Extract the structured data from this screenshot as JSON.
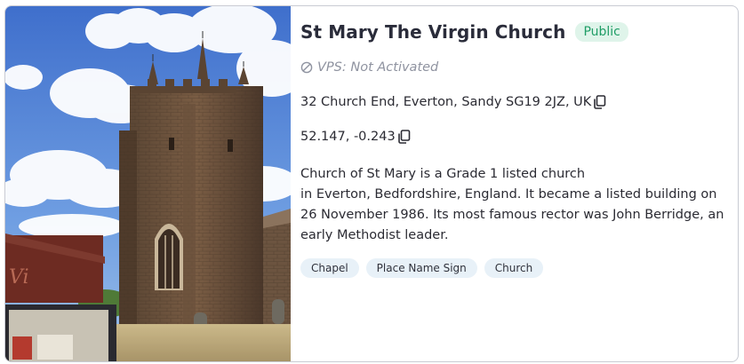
{
  "place": {
    "title": "St Mary The Virgin Church",
    "status_badge": "Public",
    "vps_status": "VPS: Not Activated",
    "address": "32 Church End, Everton, Sandy SG19 2JZ, UK",
    "coordinates": "52.147, -0.243",
    "description_lines": [
      "Church of St Mary is a Grade 1 listed church",
      "in Everton, Bedfordshire, England. It became a listed building on",
      "26 November 1986. Its most famous rector was John Berridge, an",
      "early Methodist leader."
    ],
    "tags": [
      "Chapel",
      "Place Name Sign",
      "Church"
    ],
    "sign_text": "Vi"
  },
  "icons": {
    "vps": "ban-icon",
    "copy": "copy-icon"
  },
  "colors": {
    "badge_bg": "#dff4ea",
    "badge_text": "#1f9d66",
    "tag_bg": "#e8f1f8",
    "muted_text": "#8f93a0",
    "card_border": "#c9cbd3"
  }
}
